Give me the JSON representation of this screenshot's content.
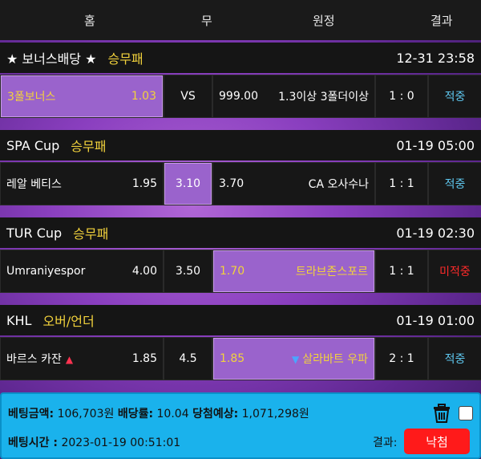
{
  "header": {
    "home": "홈",
    "draw": "무",
    "away": "원정",
    "result": "결과"
  },
  "games": [
    {
      "league": "★ 보너스배당 ★",
      "type": "승무패",
      "time": "12-31 23:58",
      "home_name": "3폴보너스",
      "home_odds": "1.03",
      "draw_odds": "VS",
      "away_odds": "999.00",
      "away_name": "1.3이상 3폴더이상",
      "score": "1 : 0",
      "status": "적중"
    },
    {
      "league": "SPA Cup",
      "type": "승무패",
      "time": "01-19 05:00",
      "home_name": "레알 베티스",
      "home_odds": "1.95",
      "draw_odds": "3.10",
      "away_odds": "3.70",
      "away_name": "CA 오사수나",
      "score": "1 : 1",
      "status": "적중"
    },
    {
      "league": "TUR Cup",
      "type": "승무패",
      "time": "01-19 02:30",
      "home_name": "Umraniyespor",
      "home_odds": "4.00",
      "draw_odds": "3.50",
      "away_odds": "1.70",
      "away_name": "트라브존스포르",
      "score": "1 : 1",
      "status": "미적중"
    },
    {
      "league": "KHL",
      "type": "오버/언더",
      "time": "01-19 01:00",
      "home_name": "바르스 카잔",
      "home_odds": "1.85",
      "draw_odds": "4.5",
      "away_odds": "1.85",
      "away_name": "살라바트 우파",
      "score": "2 : 1",
      "status": "적중"
    }
  ],
  "summary": {
    "bet_amount_label": "베팅금액:",
    "bet_amount": "106,703원",
    "odds_label": "배당률:",
    "odds": "10.04",
    "expected_label": "당첨예상:",
    "expected": "1,071,298원",
    "bet_time_label": "베팅시간 :",
    "bet_time": "2023-01-19 00:51:01",
    "result_label": "결과:",
    "result": "낙첨"
  },
  "colors": {
    "selected": "#9a63cc",
    "win": "#5fc8f0",
    "lose": "#ff2a2a",
    "type": "#f2d23c",
    "panel": "#1ab2ec"
  }
}
